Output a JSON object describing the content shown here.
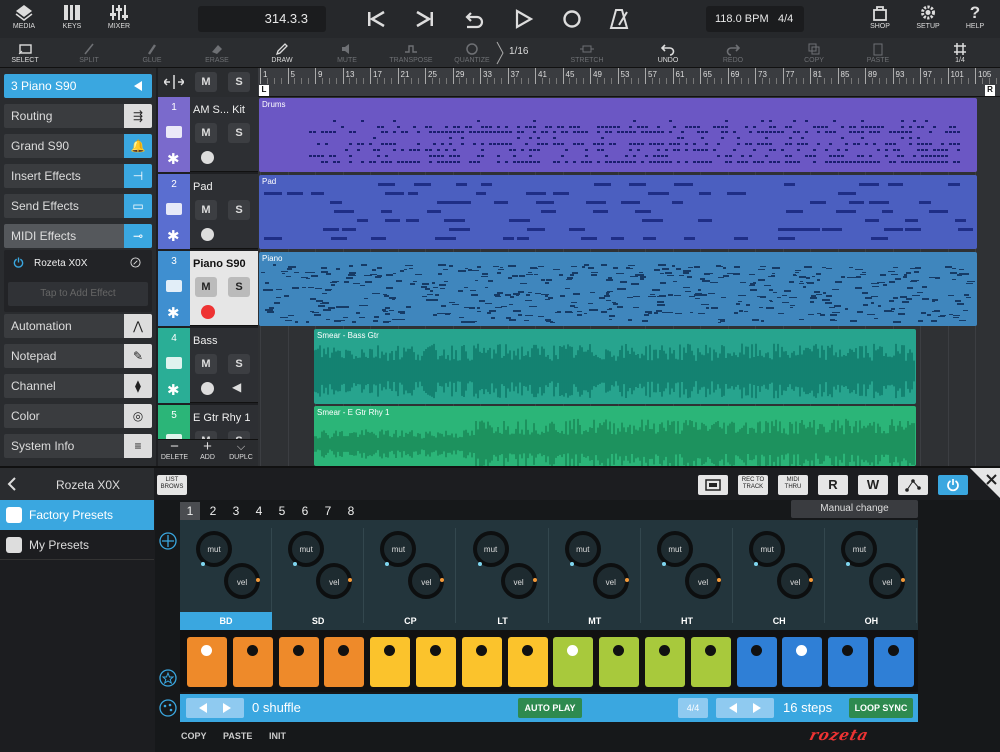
{
  "toolbar": {
    "media": "MEDIA",
    "keys": "KEYS",
    "mixer": "MIXER",
    "position": "314.3.3",
    "tempo": "118.0 BPM",
    "signature": "4/4",
    "shop": "SHOP",
    "setup": "SETUP",
    "help": "HELP"
  },
  "tools": {
    "select": "SELECT",
    "split": "SPLIT",
    "glue": "GLUE",
    "erase": "ERASE",
    "draw": "DRAW",
    "mute": "MUTE",
    "transpose": "TRANSPOSE",
    "quantize": "QUANTIZE",
    "quantize_value": "1/16",
    "stretch": "STRETCH",
    "undo": "UNDO",
    "redo": "REDO",
    "copy": "COPY",
    "paste": "PASTE",
    "grid": "1/4"
  },
  "inspector": {
    "track_title": "3  Piano S90",
    "items": [
      "Routing",
      "Grand S90",
      "Insert Effects",
      "Send Effects",
      "MIDI Effects",
      "Automation",
      "Notepad",
      "Channel",
      "Color",
      "System Info"
    ],
    "effect_name": "Rozeta X0X",
    "add_effect": "Tap to Add Effect"
  },
  "tracks": [
    {
      "num": "1",
      "name": "AM S... Kit",
      "m": "M",
      "s": "S"
    },
    {
      "num": "2",
      "name": "Pad",
      "m": "M",
      "s": "S"
    },
    {
      "num": "3",
      "name": "Piano S90",
      "m": "M",
      "s": "S"
    },
    {
      "num": "4",
      "name": "Bass",
      "m": "M",
      "s": "S"
    },
    {
      "num": "5",
      "name": "E Gtr Rhy 1",
      "m": "M",
      "s": "S"
    }
  ],
  "track_actions": {
    "delete": "DELETE",
    "add": "ADD",
    "duplicate": "DUPLC"
  },
  "ruler": [
    "1",
    "5",
    "9",
    "13",
    "17",
    "21",
    "25",
    "29",
    "33",
    "37",
    "41",
    "45",
    "49",
    "53",
    "57",
    "61",
    "65",
    "69",
    "73",
    "77",
    "81",
    "85",
    "89",
    "93",
    "97",
    "101",
    "105"
  ],
  "ruler_markers": {
    "left": "L",
    "right": "R"
  },
  "regions": {
    "drums": "Drums",
    "pad": "Pad",
    "piano": "Piano",
    "bass": "Smear - Bass Gtr",
    "gtr": "Smear - E Gtr Rhy 1"
  },
  "lower": {
    "title": "Rozeta X0X",
    "list_browse": "LIST BROWS",
    "presets": [
      "Factory Presets",
      "My Presets"
    ],
    "rec_to_track": "REC TO TRACK",
    "midi_thru": "MIDI THRU",
    "r": "R",
    "w": "W",
    "patterns": [
      "1",
      "2",
      "3",
      "4",
      "5",
      "6",
      "7",
      "8"
    ],
    "manual_change": "Manual change",
    "knob_mut": "mut",
    "knob_vel": "vel",
    "instruments": [
      "BD",
      "SD",
      "CP",
      "LT",
      "MT",
      "HT",
      "CH",
      "OH"
    ],
    "shuffle": "0 shuffle",
    "auto_play": "AUTO PLAY",
    "meter": "4/4",
    "steps": "16 steps",
    "loop_sync": "LOOP SYNC",
    "copy": "COPY",
    "paste": "PASTE",
    "init": "INIT",
    "logo": "rozeta"
  },
  "colors": {
    "drums": "#6b57c4",
    "pad": "#4b5fc0",
    "piano": "#3f86bd",
    "audio": "#2bb59b",
    "accent": "#3aa7e0"
  }
}
